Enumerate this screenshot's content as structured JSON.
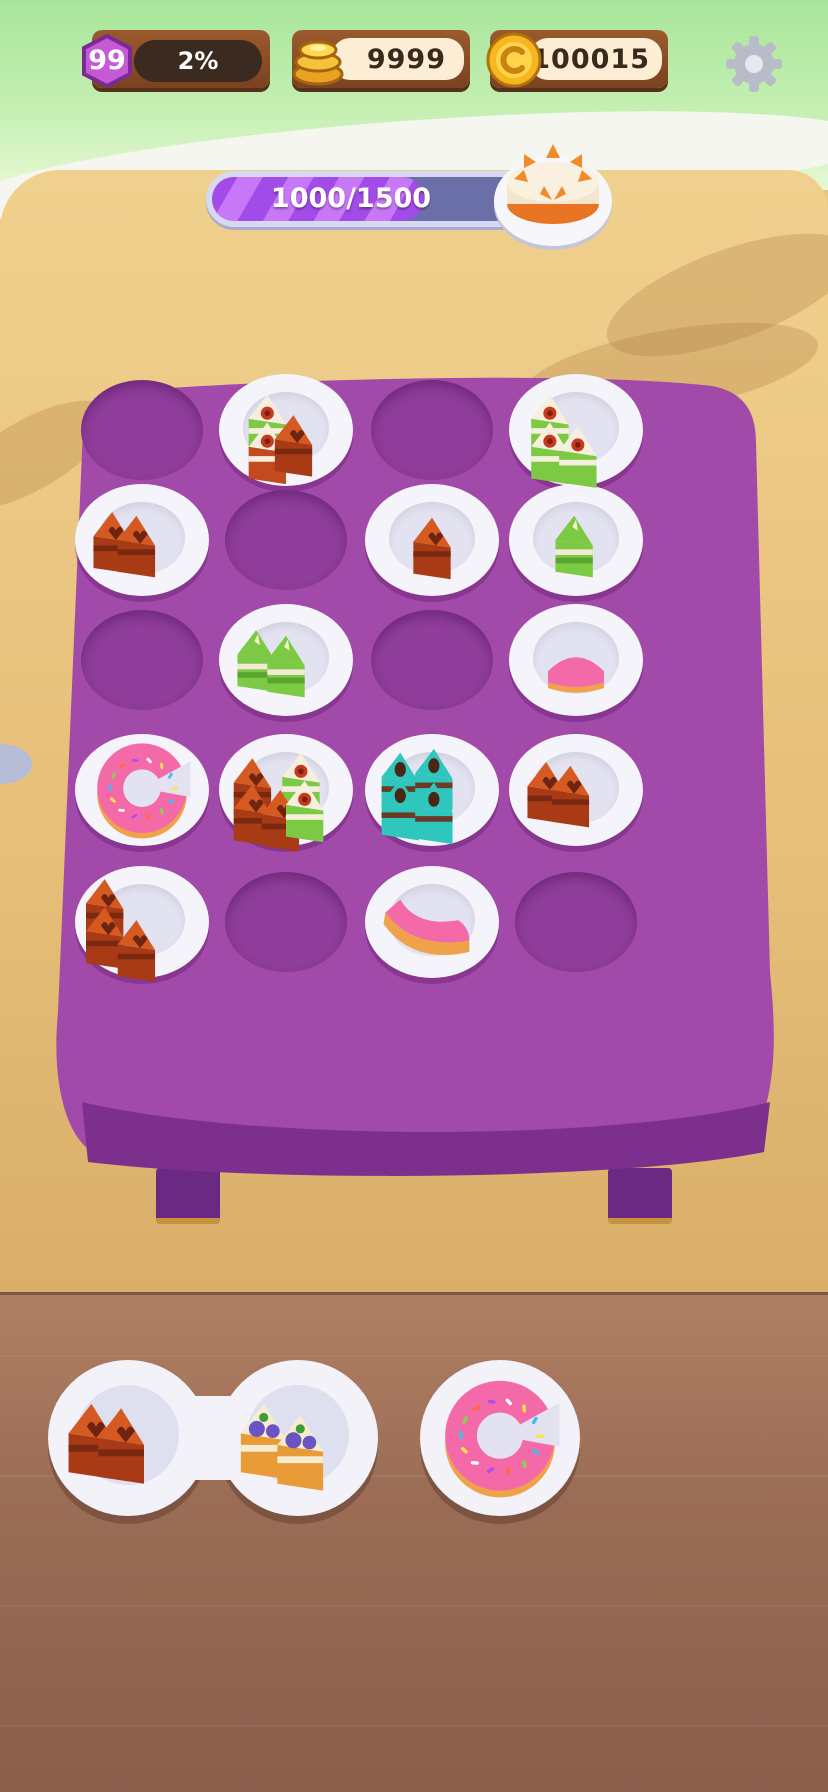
{
  "hud": {
    "level": "99",
    "xp_percent": "2%",
    "gems": "9999",
    "coins": "100015",
    "settings_icon": "gear-icon",
    "gem_icon": "gold-stack-icon",
    "coin_icon": "gold-coin-icon"
  },
  "goal": {
    "progress_text": "1000/1500",
    "progress_fraction": 0.6667,
    "target_icon": "orange-cake-icon"
  },
  "board": {
    "rows": 5,
    "cols": 4,
    "cells": [
      {
        "row": 1,
        "col": 1,
        "plate": false,
        "contents": ""
      },
      {
        "row": 1,
        "col": 2,
        "plate": true,
        "contents": "cream-cake-slices-with-chocolate-slice"
      },
      {
        "row": 1,
        "col": 3,
        "plate": false,
        "contents": ""
      },
      {
        "row": 1,
        "col": 4,
        "plate": true,
        "contents": "cream-cake-slices-with-green-layer"
      },
      {
        "row": 2,
        "col": 1,
        "plate": true,
        "contents": "chocolate-heart-slices"
      },
      {
        "row": 2,
        "col": 2,
        "plate": false,
        "contents": ""
      },
      {
        "row": 2,
        "col": 3,
        "plate": true,
        "contents": "chocolate-heart-slice"
      },
      {
        "row": 2,
        "col": 4,
        "plate": true,
        "contents": "matcha-cake-slice"
      },
      {
        "row": 3,
        "col": 1,
        "plate": false,
        "contents": ""
      },
      {
        "row": 3,
        "col": 2,
        "plate": true,
        "contents": "matcha-cake-slices"
      },
      {
        "row": 3,
        "col": 3,
        "plate": false,
        "contents": ""
      },
      {
        "row": 3,
        "col": 4,
        "plate": true,
        "contents": "pink-donut-piece"
      },
      {
        "row": 4,
        "col": 1,
        "plate": true,
        "contents": "pink-donut-large"
      },
      {
        "row": 4,
        "col": 2,
        "plate": true,
        "contents": "chocolate-and-cream-cake-mix"
      },
      {
        "row": 4,
        "col": 3,
        "plate": true,
        "contents": "teal-chocolate-cake"
      },
      {
        "row": 4,
        "col": 4,
        "plate": true,
        "contents": "chocolate-heart-slices"
      },
      {
        "row": 5,
        "col": 1,
        "plate": true,
        "contents": "chocolate-heart-slices-stack"
      },
      {
        "row": 5,
        "col": 2,
        "plate": false,
        "contents": ""
      },
      {
        "row": 5,
        "col": 3,
        "plate": true,
        "contents": "pink-donut-half"
      },
      {
        "row": 5,
        "col": 4,
        "plate": false,
        "contents": ""
      }
    ]
  },
  "tray": {
    "items": [
      {
        "contents": "chocolate-heart-slices"
      },
      {
        "contents": "blueberry-cheesecake-slices"
      },
      {
        "contents": "pink-donut-large"
      }
    ]
  },
  "colors": {
    "table": "#a14aa9",
    "sand": "#e9c583",
    "counter": "#9b6d56",
    "progress_fill": "#b661f0",
    "hud_wood": "#8b4b25"
  }
}
